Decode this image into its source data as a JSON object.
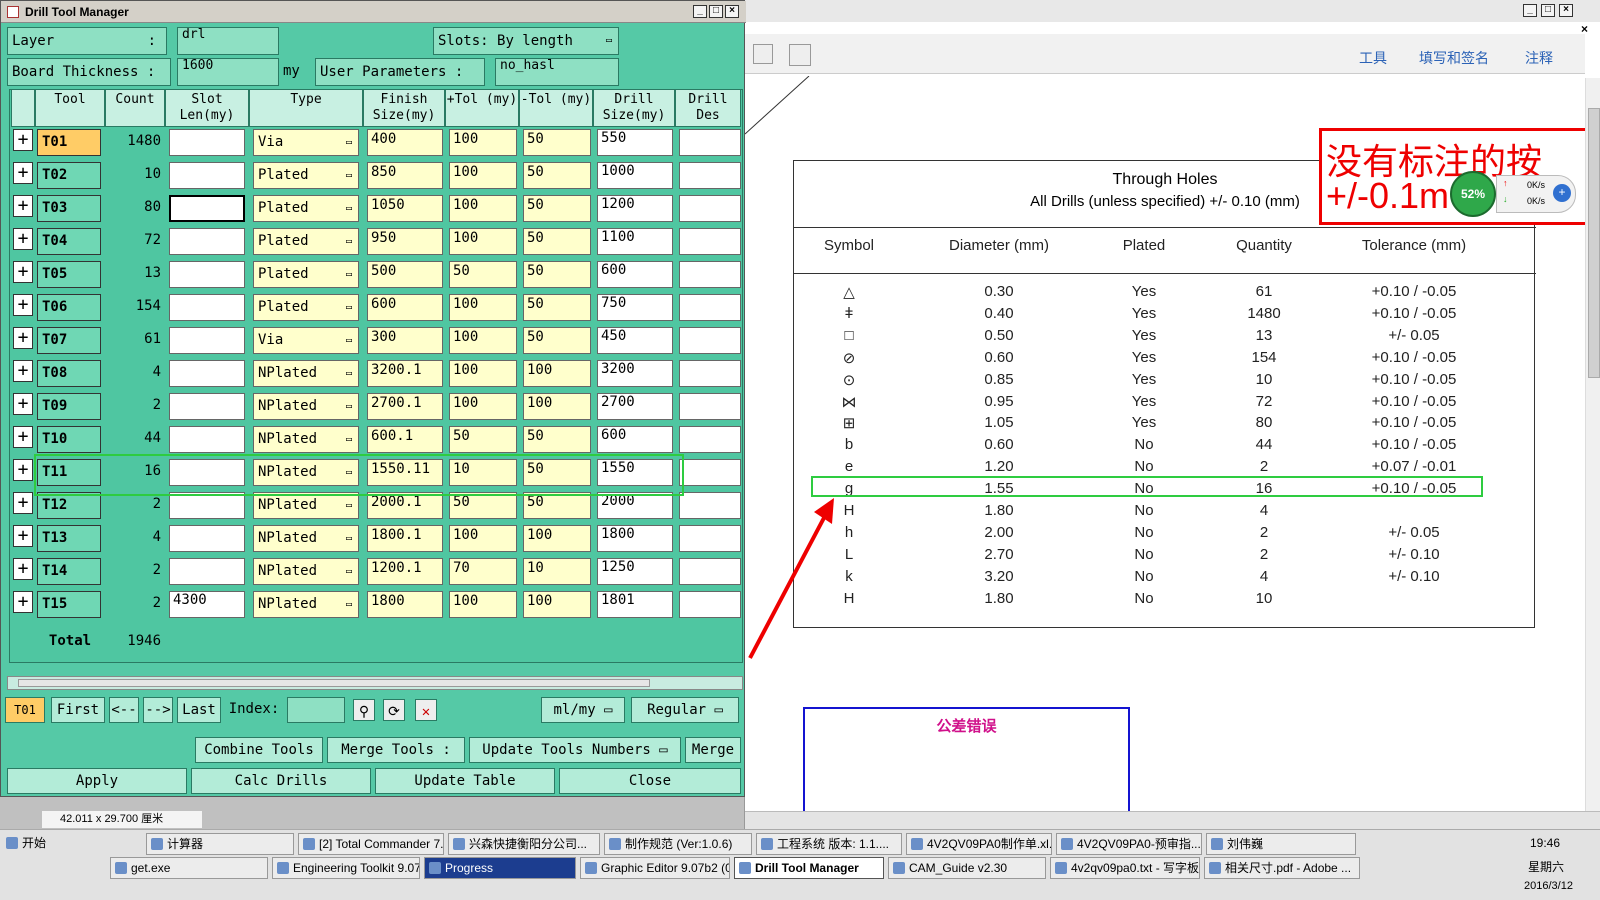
{
  "drill_tool_manager": {
    "title": "Drill Tool Manager",
    "layer_label": "Layer",
    "layer_value": "drl",
    "slots_label": "Slots:",
    "slots_value": "By length",
    "board_thickness_label": "Board Thickness :",
    "board_thickness_value": "1600",
    "board_thickness_unit": "my",
    "user_params_label": "User Parameters :",
    "user_params_value": "no_hasl",
    "columns": [
      "Tool",
      "Count",
      "Slot Len(my)",
      "Type",
      "Finish Size(my)",
      "+Tol (my)",
      "-Tol (my)",
      "Drill Size(my)",
      "Drill Des"
    ],
    "rows": [
      {
        "tool": "T01",
        "count": "1480",
        "slot": "",
        "type": "Via",
        "finish": "400",
        "ptol": "100",
        "ntol": "50",
        "drill": "550"
      },
      {
        "tool": "T02",
        "count": "10",
        "slot": "",
        "type": "Plated",
        "finish": "850",
        "ptol": "100",
        "ntol": "50",
        "drill": "1000"
      },
      {
        "tool": "T03",
        "count": "80",
        "slot": "",
        "type": "Plated",
        "finish": "1050",
        "ptol": "100",
        "ntol": "50",
        "drill": "1200"
      },
      {
        "tool": "T04",
        "count": "72",
        "slot": "",
        "type": "Plated",
        "finish": "950",
        "ptol": "100",
        "ntol": "50",
        "drill": "1100"
      },
      {
        "tool": "T05",
        "count": "13",
        "slot": "",
        "type": "Plated",
        "finish": "500",
        "ptol": "50",
        "ntol": "50",
        "drill": "600"
      },
      {
        "tool": "T06",
        "count": "154",
        "slot": "",
        "type": "Plated",
        "finish": "600",
        "ptol": "100",
        "ntol": "50",
        "drill": "750"
      },
      {
        "tool": "T07",
        "count": "61",
        "slot": "",
        "type": "Via",
        "finish": "300",
        "ptol": "100",
        "ntol": "50",
        "drill": "450"
      },
      {
        "tool": "T08",
        "count": "4",
        "slot": "",
        "type": "NPlated",
        "finish": "3200.1",
        "ptol": "100",
        "ntol": "100",
        "drill": "3200"
      },
      {
        "tool": "T09",
        "count": "2",
        "slot": "",
        "type": "NPlated",
        "finish": "2700.1",
        "ptol": "100",
        "ntol": "100",
        "drill": "2700"
      },
      {
        "tool": "T10",
        "count": "44",
        "slot": "",
        "type": "NPlated",
        "finish": "600.1",
        "ptol": "50",
        "ntol": "50",
        "drill": "600"
      },
      {
        "tool": "T11",
        "count": "16",
        "slot": "",
        "type": "NPlated",
        "finish": "1550.11",
        "ptol": "10",
        "ntol": "50",
        "drill": "1550"
      },
      {
        "tool": "T12",
        "count": "2",
        "slot": "",
        "type": "NPlated",
        "finish": "2000.1",
        "ptol": "50",
        "ntol": "50",
        "drill": "2000"
      },
      {
        "tool": "T13",
        "count": "4",
        "slot": "",
        "type": "NPlated",
        "finish": "1800.1",
        "ptol": "100",
        "ntol": "100",
        "drill": "1800"
      },
      {
        "tool": "T14",
        "count": "2",
        "slot": "",
        "type": "NPlated",
        "finish": "1200.1",
        "ptol": "70",
        "ntol": "10",
        "drill": "1250"
      },
      {
        "tool": "T15",
        "count": "2",
        "slot": "4300",
        "type": "NPlated",
        "finish": "1800",
        "ptol": "100",
        "ntol": "100",
        "drill": "1801"
      }
    ],
    "total_label": "Total",
    "total_value": "1946",
    "nav": {
      "current_tool": "T01",
      "first": "First",
      "prev": "<--",
      "next": "-->",
      "last": "Last",
      "index_label": "Index:",
      "units": "ml/my",
      "mode": "Regular"
    },
    "buttons": {
      "combine": "Combine Tools",
      "merge_tools": "Merge Tools :",
      "update_numbers": "Update Tools Numbers",
      "merge": "Merge",
      "apply": "Apply",
      "calc": "Calc Drills",
      "update_table": "Update Table",
      "close": "Close"
    },
    "status_size": "42.011 x 29.700 厘米"
  },
  "pdf_viewer": {
    "toolbar": [
      "工具",
      "填写和签名",
      "注释"
    ],
    "table_title": "Through Holes",
    "table_subtitle": "All Drills (unless specified) +/- 0.10 (mm)",
    "headers": [
      "Symbol",
      "Diameter (mm)",
      "Plated",
      "Quantity",
      "Tolerance (mm)"
    ],
    "rows": [
      {
        "symbol": "△",
        "diameter": "0.30",
        "plated": "Yes",
        "qty": "61",
        "tol": "+0.10 / -0.05"
      },
      {
        "symbol": "ǂ",
        "diameter": "0.40",
        "plated": "Yes",
        "qty": "1480",
        "tol": "+0.10 / -0.05"
      },
      {
        "symbol": "□",
        "diameter": "0.50",
        "plated": "Yes",
        "qty": "13",
        "tol": "+/- 0.05"
      },
      {
        "symbol": "⊘",
        "diameter": "0.60",
        "plated": "Yes",
        "qty": "154",
        "tol": "+0.10 / -0.05"
      },
      {
        "symbol": "⊙",
        "diameter": "0.85",
        "plated": "Yes",
        "qty": "10",
        "tol": "+0.10 / -0.05"
      },
      {
        "symbol": "⋈",
        "diameter": "0.95",
        "plated": "Yes",
        "qty": "72",
        "tol": "+0.10 / -0.05"
      },
      {
        "symbol": "⊞",
        "diameter": "1.05",
        "plated": "Yes",
        "qty": "80",
        "tol": "+0.10 / -0.05"
      },
      {
        "symbol": "b",
        "diameter": "0.60",
        "plated": "No",
        "qty": "44",
        "tol": "+0.10 / -0.05"
      },
      {
        "symbol": "e",
        "diameter": "1.20",
        "plated": "No",
        "qty": "2",
        "tol": "+0.07 / -0.01"
      },
      {
        "symbol": "g",
        "diameter": "1.55",
        "plated": "No",
        "qty": "16",
        "tol": "+0.10 / -0.05"
      },
      {
        "symbol": "H",
        "diameter": "1.80",
        "plated": "No",
        "qty": "4",
        "tol": ""
      },
      {
        "symbol": "h",
        "diameter": "2.00",
        "plated": "No",
        "qty": "2",
        "tol": "+/- 0.05"
      },
      {
        "symbol": "L",
        "diameter": "2.70",
        "plated": "No",
        "qty": "2",
        "tol": "+/- 0.10"
      },
      {
        "symbol": "k",
        "diameter": "3.20",
        "plated": "No",
        "qty": "4",
        "tol": "+/- 0.10"
      },
      {
        "symbol": "H",
        "diameter": "1.80",
        "plated": "No",
        "qty": "10",
        "tol": ""
      }
    ],
    "red_note_line1": "没有标注的按",
    "red_note_line2": "+/-0.1m",
    "speed_percent": "52%",
    "speed_up": "0K/s",
    "speed_down": "0K/s",
    "blue_note": "公差错误"
  },
  "taskbar": {
    "start": "开始",
    "row1": [
      "计算器",
      "[2] Total Commander 7....",
      "兴森快捷衡阳分公司...",
      "制作规范 (Ver:1.0.6)",
      "工程系统  版本: 1.1....",
      "4V2QV09PA0制作单.xl...",
      "4V2QV09PA0-预审指...",
      "刘伟巍"
    ],
    "row2": [
      "get.exe",
      "Engineering Toolkit 9.07...",
      "Progress",
      "Graphic Editor 9.07b2 (0...",
      "Drill Tool Manager",
      "CAM_Guide v2.30",
      "4v2qv09pa0.txt - 写字板",
      "相关尺寸.pdf - Adobe ..."
    ],
    "time": "19:46",
    "weekday": "星期六",
    "date": "2016/3/12"
  },
  "colors": {
    "highlight_green": "#2ecc40",
    "note_red": "#e00000",
    "blue_box": "#1414d0",
    "panel": "#55c9a6"
  }
}
